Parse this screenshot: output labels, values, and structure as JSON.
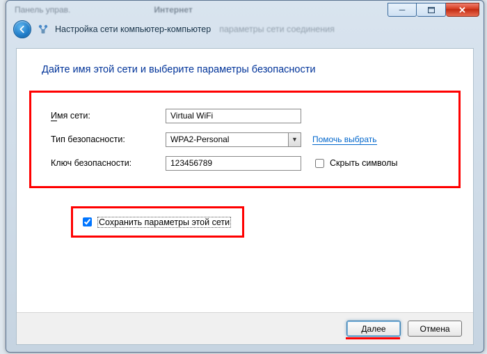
{
  "titlebar": {
    "left_ghost": "Панель управ.",
    "mid_ghost": "Интернет"
  },
  "nav": {
    "wizard_title": "Настройка сети компьютер-компьютер",
    "ghost_tail": "параметры сети соединения"
  },
  "heading": "Дайте имя этой сети и выберите параметры безопасности",
  "form": {
    "name_label_u": "И",
    "name_label_rest": "мя сети:",
    "name_value": "Virtual WiFi",
    "sec_label": "Тип безопасности:",
    "sec_value": "WPA2-Personal",
    "help_link": "Помочь выбрать",
    "key_label": "Ключ безопасности:",
    "key_value": "123456789",
    "hide_label": "Скрыть символы"
  },
  "save": {
    "label": "Сохранить параметры этой сети"
  },
  "footer": {
    "next_u": "Д",
    "next_rest": "алее",
    "cancel": "Отмена"
  }
}
